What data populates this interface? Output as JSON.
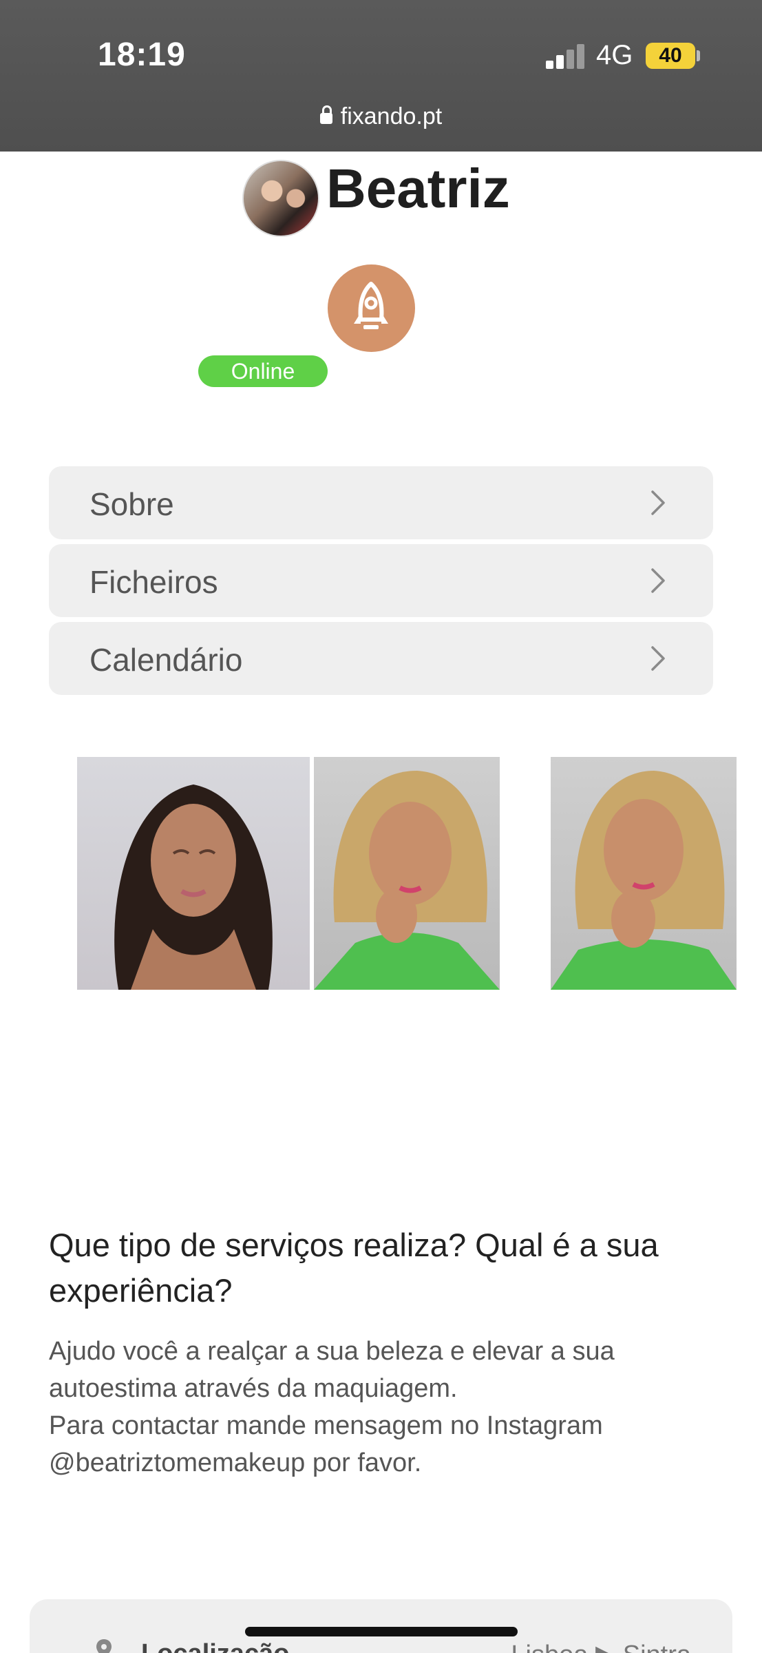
{
  "status_bar": {
    "time": "18:19",
    "network": "4G",
    "battery": "40",
    "url": "fixando.pt"
  },
  "profile": {
    "name": "Beatriz",
    "status": "Online",
    "badge_icon": "rocket-icon",
    "colors": {
      "badge": "#d4936a",
      "online": "#5fd047"
    }
  },
  "menu": {
    "items": [
      {
        "label": "Sobre"
      },
      {
        "label": "Ficheiros"
      },
      {
        "label": "Calendário"
      }
    ]
  },
  "section": {
    "question": "Que tipo de serviços realiza? Qual é a sua experiência?",
    "answer_lines": [
      "Ajudo você a realçar a sua beleza e elevar a sua",
      "autoestima através da maquiagem.",
      "Para contactar mande mensagem no Instagram",
      "@beatriztomemakeup por favor."
    ]
  },
  "location": {
    "label": "Localização",
    "path_from": "Lisboa",
    "path_to": "Sintra"
  }
}
